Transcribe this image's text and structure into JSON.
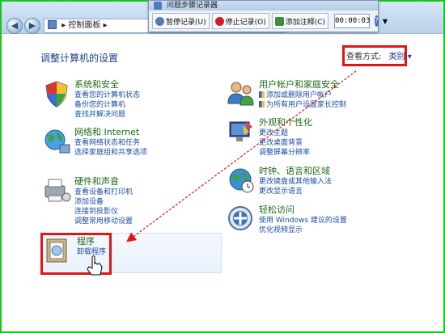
{
  "window": {
    "address": "控制面板",
    "nav_back": "◀",
    "nav_fwd": "▶"
  },
  "recorder": {
    "title": "问题步骤记录器",
    "pause_label": "暂停记录(U)",
    "stop_label": "停止记录(O)",
    "add_comment_label": "添加注释(C)",
    "timer": "00:00:03",
    "help": "?",
    "dropdown": "▼"
  },
  "main": {
    "title": "调整计算机的设置",
    "view_by_label": "查看方式:",
    "view_by_value": "类别 ▾"
  },
  "categories": [
    {
      "id": "system-security",
      "heading": "系统和安全",
      "links": [
        "查看您的计算机状态",
        "备份您的计算机",
        "查找并解决问题"
      ]
    },
    {
      "id": "network",
      "heading": "网络和 Internet",
      "links": [
        "查看网络状态和任务",
        "选择家庭组和共享选项"
      ]
    },
    {
      "id": "hardware",
      "heading": "硬件和声音",
      "links": [
        "查看设备和打印机",
        "添加设备",
        "连接到投影仪",
        "调整常用移动设置"
      ]
    },
    {
      "id": "programs",
      "heading": "程序",
      "links": [
        "卸载程序"
      ]
    },
    {
      "id": "user-accounts",
      "heading": "用户帐户和家庭安全",
      "links": [
        "添加或删除用户帐户",
        "为所有用户设置家长控制"
      ]
    },
    {
      "id": "appearance",
      "heading": "外观和个性化",
      "links": [
        "更改主题",
        "更改桌面背景",
        "调整屏幕分辨率"
      ]
    },
    {
      "id": "clock",
      "heading": "时钟、语言和区域",
      "links": [
        "更改键盘或其他输入法",
        "更改显示语言"
      ]
    },
    {
      "id": "ease",
      "heading": "轻松访问",
      "links": [
        "使用 Windows 建议的设置",
        "优化视频显示"
      ]
    }
  ],
  "colors": {
    "frame": "#1ec41e",
    "highlight_box": "#e01515",
    "heading": "#1c6a18",
    "link": "#1b4ea3"
  }
}
